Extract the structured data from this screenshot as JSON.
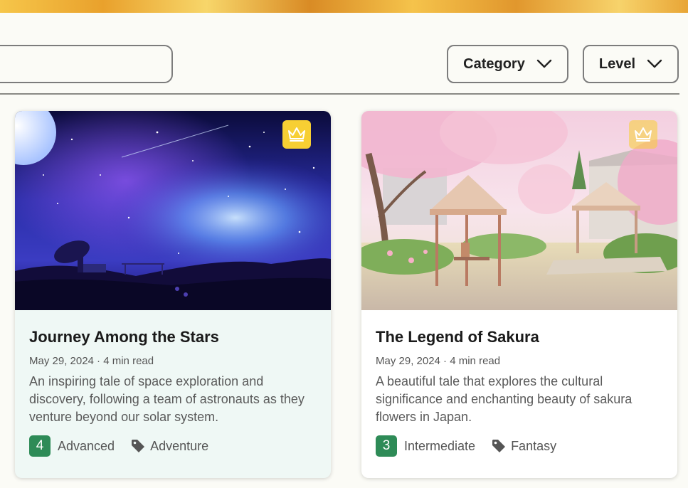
{
  "filters": {
    "category_label": "Category",
    "level_label": "Level"
  },
  "cards": [
    {
      "title": "Journey Among the Stars",
      "date": "May 29, 2024",
      "read_time": "4 min read",
      "meta": "May 29, 2024 · 4 min read",
      "description": "An inspiring tale of space exploration and discovery, following a team of astronauts as they venture beyond our solar system.",
      "level_number": "4",
      "level_name": "Advanced",
      "tag": "Adventure",
      "image_subject": "starry night sky over a radio telescope"
    },
    {
      "title": "The Legend of Sakura",
      "date": "May 29, 2024",
      "read_time": "4 min read",
      "meta": "May 29, 2024 · 4 min read",
      "description": "A beautiful tale that explores the cultural significance and enchanting beauty of sakura flowers in Japan.",
      "level_number": "3",
      "level_name": "Intermediate",
      "tag": "Fantasy",
      "image_subject": "cherry blossom garden with gazebos"
    }
  ],
  "colors": {
    "level_badge": "#2e8b57",
    "premium_badge": "#f7cf33",
    "page_background": "#fbfbf6"
  },
  "icons": {
    "premium": "crown-icon",
    "tag": "tag-icon",
    "dropdown": "chevron-down-icon"
  }
}
